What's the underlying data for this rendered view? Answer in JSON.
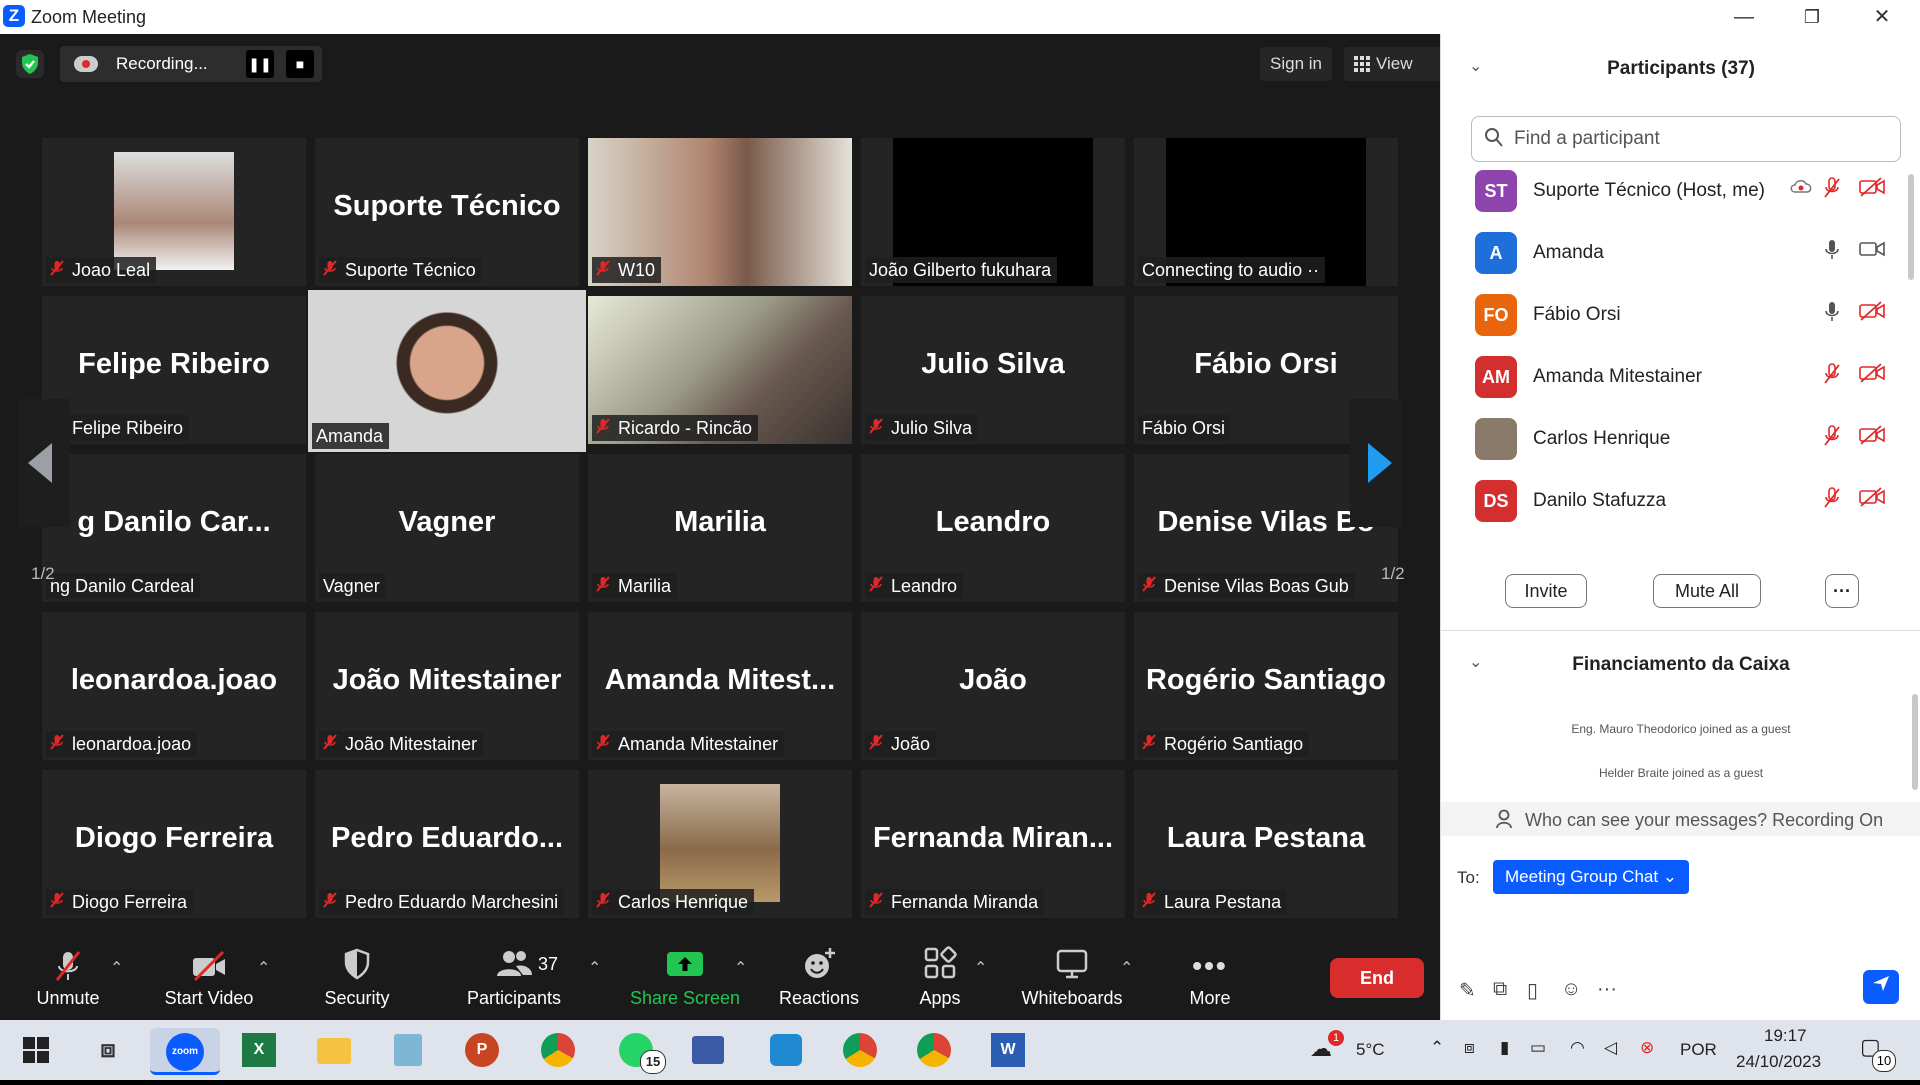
{
  "window": {
    "title": "Zoom Meeting",
    "logo": "Z",
    "min": "—",
    "max": "❐",
    "close": "✕"
  },
  "topbar": {
    "recording": "Recording...",
    "pause": "❚❚",
    "stop": "■",
    "sign_in": "Sign in",
    "view": "View"
  },
  "grid": {
    "page": "1/2",
    "tiles": [
      {
        "big": "",
        "label": "Joao Leal",
        "muted": true
      },
      {
        "big": "Suporte Técnico",
        "label": "Suporte Técnico",
        "muted": true
      },
      {
        "big": "",
        "label": "W10",
        "muted": true
      },
      {
        "big": "",
        "label": "João Gilberto fukuhara",
        "muted": false
      },
      {
        "big": "",
        "label": "Connecting to audio ··",
        "muted": false
      },
      {
        "big": "Felipe Ribeiro",
        "label": "Felipe Ribeiro",
        "muted": true
      },
      {
        "big": "",
        "label": "Amanda",
        "muted": false
      },
      {
        "big": "",
        "label": "Ricardo - Rincão",
        "muted": true
      },
      {
        "big": "Julio Silva",
        "label": "Julio Silva",
        "muted": true
      },
      {
        "big": "Fábio Orsi",
        "label": "Fábio Orsi",
        "muted": false
      },
      {
        "big": "g  Danilo Car...",
        "label": "ng  Danilo Cardeal",
        "muted": false
      },
      {
        "big": "Vagner",
        "label": "Vagner",
        "muted": false
      },
      {
        "big": "Marilia",
        "label": "Marilia",
        "muted": true
      },
      {
        "big": "Leandro",
        "label": "Leandro",
        "muted": true
      },
      {
        "big": "Denise  Vilas  Bo",
        "label": "Denise Vilas Boas Gub",
        "muted": true
      },
      {
        "big": "leonardoa.joao",
        "label": "leonardoa.joao",
        "muted": true
      },
      {
        "big": "João Mitestainer",
        "label": "João Mitestainer",
        "muted": true
      },
      {
        "big": "Amanda  Mitest...",
        "label": "Amanda Mitestainer",
        "muted": true
      },
      {
        "big": "João",
        "label": "João",
        "muted": true
      },
      {
        "big": "Rogério Santiago",
        "label": "Rogério Santiago",
        "muted": true
      },
      {
        "big": "Diogo Ferreira",
        "label": "Diogo Ferreira",
        "muted": true
      },
      {
        "big": "Pedro  Eduardo...",
        "label": "Pedro Eduardo Marchesini",
        "muted": true
      },
      {
        "big": "",
        "label": "Carlos Henrique",
        "muted": true
      },
      {
        "big": "Fernanda  Miran...",
        "label": "Fernanda Miranda",
        "muted": true
      },
      {
        "big": "Laura Pestana",
        "label": "Laura Pestana",
        "muted": true
      }
    ]
  },
  "toolbar": {
    "unmute": "Unmute",
    "start_video": "Start Video",
    "security": "Security",
    "participants": "Participants",
    "participants_count": "37",
    "share_screen": "Share Screen",
    "reactions": "Reactions",
    "apps": "Apps",
    "whiteboards": "Whiteboards",
    "more": "More",
    "end": "End",
    "accent_green": "#23c552",
    "end_color": "#d92d2d"
  },
  "panel": {
    "participants_title": "Participants (37)",
    "search_placeholder": "Find a participant",
    "participants": [
      {
        "initials": "ST",
        "name": "Suporte Técnico (Host, me)",
        "color": "#8e44ad"
      },
      {
        "initials": "A",
        "name": "Amanda",
        "color": "#1e6fd9"
      },
      {
        "initials": "FO",
        "name": "Fábio Orsi",
        "color": "#e8650b"
      },
      {
        "initials": "AM",
        "name": "Amanda Mitestainer",
        "color": "#d32f2f"
      },
      {
        "initials": "",
        "name": "Carlos Henrique",
        "color": "#8a7a6a"
      },
      {
        "initials": "DS",
        "name": "Danilo Stafuzza",
        "color": "#d32f2f"
      }
    ],
    "invite": "Invite",
    "mute_all": "Mute All",
    "more": "···",
    "chat_title": "Financiamento da Caixa",
    "chat_msgs": [
      "Eng. Mauro Theodorico joined as a guest",
      "Helder Braite joined as a guest"
    ],
    "notice": "Who can see your messages? Recording On",
    "to_label": "To:",
    "to_value": "Meeting Group Chat ⌄"
  },
  "taskbar": {
    "weather": "5°C",
    "weather_badge": "1",
    "lang": "POR",
    "time": "19:17",
    "date": "24/10/2023",
    "notif": "10",
    "whatsapp_badge": "15",
    "zoom_label": "zoom"
  }
}
